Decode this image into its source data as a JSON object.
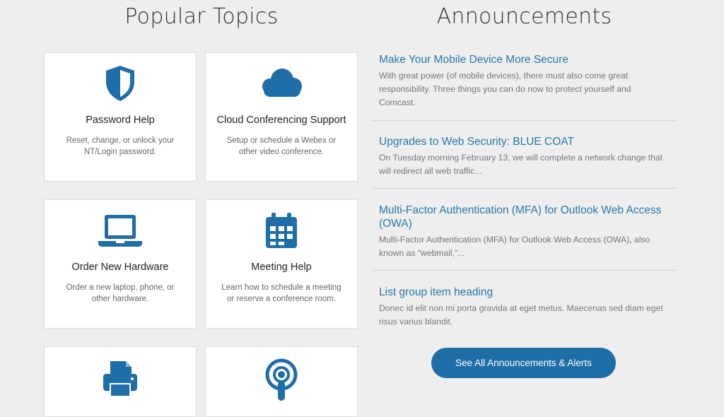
{
  "popular_topics": {
    "heading": "Popular Topics",
    "cards": [
      {
        "icon": "shield-icon",
        "title": "Password Help",
        "description": "Reset, change, or unlock your NT/Login password."
      },
      {
        "icon": "cloud-icon",
        "title": "Cloud Conferencing Support",
        "description": "Setup or schedule a Webex or other video conference."
      },
      {
        "icon": "laptop-icon",
        "title": "Order New Hardware",
        "description": "Order a new laptop, phone, or other hardware."
      },
      {
        "icon": "calendar-icon",
        "title": "Meeting Help",
        "description": "Learn how to schedule a meeting or reserve a conference room."
      },
      {
        "icon": "printer-icon",
        "title": "",
        "description": ""
      },
      {
        "icon": "podcast-icon",
        "title": "",
        "description": ""
      }
    ]
  },
  "announcements": {
    "heading": "Announcements",
    "items": [
      {
        "title": "Make Your Mobile Device More Secure",
        "body": "With great power (of mobile devices), there must also come great responsibility. Three things you can do now to protect yourself and Comcast."
      },
      {
        "title": "Upgrades to Web Security: BLUE COAT",
        "body": "On Tuesday morning February 13, we will complete a network change that will redirect all web traffic..."
      },
      {
        "title": "Multi-Factor Authentication (MFA) for Outlook Web Access (OWA)",
        "body": "Multi-Factor Authentication (MFA) for Outlook Web Access (OWA), also known as “webmail,”..."
      },
      {
        "title": "List group item heading",
        "body": "Donec id elit non mi porta gravida at eget metus. Maecenas sed diam eget risus varius blandit."
      }
    ],
    "see_all_label": "See All Announcements & Alerts"
  },
  "colors": {
    "icon": "#1f6ea7",
    "link": "#2a77aa",
    "button": "#1f6ea7",
    "background": "#eeeeee"
  }
}
